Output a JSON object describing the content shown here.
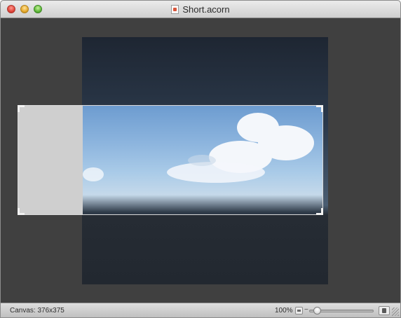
{
  "window": {
    "title": "Short.acorn"
  },
  "statusbar": {
    "canvas_label": "Canvas: 376x375",
    "zoom_level": "100%"
  }
}
